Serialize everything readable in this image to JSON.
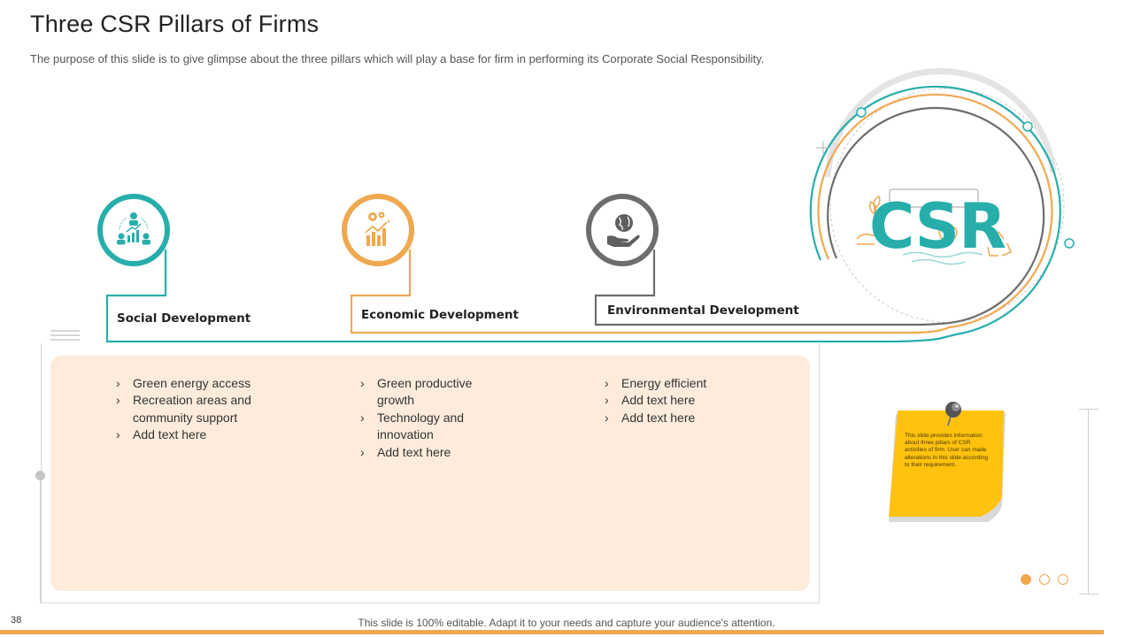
{
  "slide": {
    "title": "Three CSR Pillars of Firms",
    "subtitle": "The purpose of this slide is to give glimpse about the three pillars which will play a base for firm in performing its Corporate Social Responsibility.",
    "page_number": "38",
    "footer": "This slide is 100% editable. Adapt it to your needs and capture your audience's attention."
  },
  "colors": {
    "teal": "#27aeab",
    "orange": "#f0a850",
    "grey": "#6d6d6d",
    "panel": "#fdecdc",
    "note_yellow": "#ffc20e"
  },
  "pillars": [
    {
      "label": "Social Development",
      "icon": "community-growth-icon",
      "bullets": [
        "Green energy access",
        "Recreation areas and community support",
        "Add text here"
      ]
    },
    {
      "label": "Economic Development",
      "icon": "gear-bar-chart-icon",
      "bullets": [
        "Green productive growth",
        "Technology and innovation",
        "Add text here"
      ]
    },
    {
      "label": "Environmental Development",
      "icon": "hand-globe-icon",
      "bullets": [
        "Energy efficient",
        "Add text here",
        "Add text here"
      ]
    }
  ],
  "csr_badge": {
    "text": "CSR"
  },
  "sticky_note": {
    "text": "This slide provides information about three pillars of CSR activities of firm. User can made alterations in this slide according to their requirement."
  }
}
